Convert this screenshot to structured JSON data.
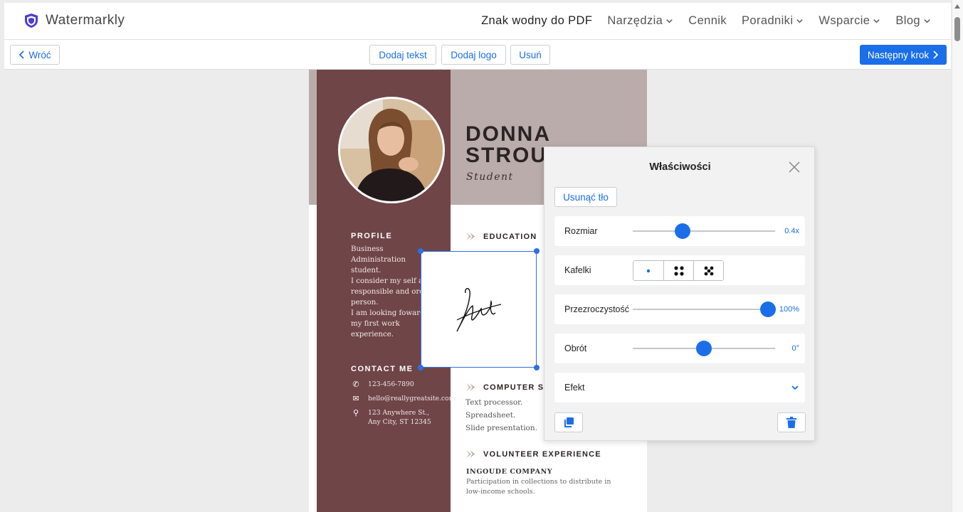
{
  "header": {
    "brand": "Watermarkly",
    "nav": [
      {
        "label": "Znak wodny do PDF",
        "dropdown": false
      },
      {
        "label": "Narzędzia",
        "dropdown": true
      },
      {
        "label": "Cennik",
        "dropdown": false
      },
      {
        "label": "Poradniki",
        "dropdown": true
      },
      {
        "label": "Wsparcie",
        "dropdown": true
      },
      {
        "label": "Blog",
        "dropdown": true
      }
    ]
  },
  "toolbar": {
    "back_label": "Wróć",
    "add_text_label": "Dodaj tekst",
    "add_logo_label": "Dodaj logo",
    "delete_label": "Usuń",
    "next_label": "Następny krok"
  },
  "document": {
    "name_line1": "DONNA",
    "name_line2": "STROUD",
    "role": "Student",
    "profile_title": "PROFILE",
    "profile_lines": [
      "Business Administration",
      "student.",
      "I consider my self a",
      "responsible and orderly",
      "person.",
      "I am looking foward for",
      "my first work",
      "experience."
    ],
    "contact_title": "CONTACT ME",
    "phone": "123-456-7890",
    "email": "hello@reallygreatsite.com",
    "address_line1": "123 Anywhere St.,",
    "address_line2": "Any City, ST 12345",
    "education_title": "EDUCATION",
    "computer_title": "COMPUTER SKILLS",
    "computer_items": [
      "Text processor.",
      "Spreadsheet.",
      "Slide presentation."
    ],
    "volunteer_title": "VOLUNTEER EXPERIENCE",
    "volunteer_company": "INGOUDE COMPANY",
    "volunteer_desc_line1": "Participation in collections to distribute in",
    "volunteer_desc_line2": "low-income schools."
  },
  "panel": {
    "title": "Właściwości",
    "remove_bg_label": "Usunąć tło",
    "size_label": "Rozmiar",
    "size_value": "0.4x",
    "size_fraction": 0.35,
    "tiles_label": "Kafelki",
    "tile_options": [
      "single",
      "grid-4",
      "pattern-5"
    ],
    "tile_selected": "single",
    "opacity_label": "Przezroczystość",
    "opacity_value": "100%",
    "opacity_fraction": 0.95,
    "rotation_label": "Obrót",
    "rotation_value": "0°",
    "rotation_fraction": 0.5,
    "effect_label": "Efekt"
  },
  "colors": {
    "accent": "#1a6ee8",
    "resume_sidebar": "#6f4548",
    "resume_header": "#b9acaa"
  }
}
